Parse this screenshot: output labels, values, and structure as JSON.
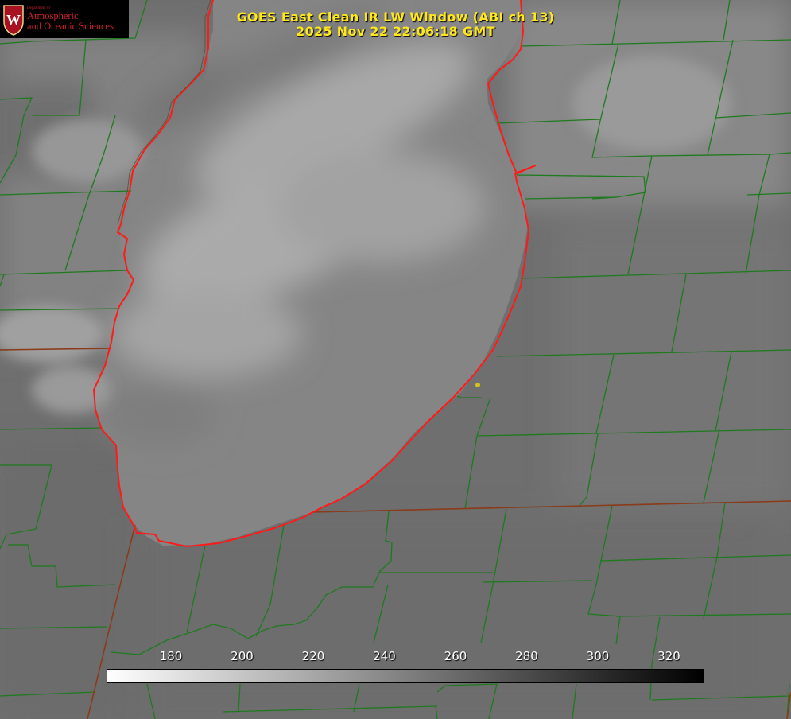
{
  "title": {
    "line1": "GOES East Clean IR LW Window (ABI ch 13)",
    "line2": "2025 Nov 22 22:06:18 GMT"
  },
  "logo": {
    "dept": "Department of",
    "line1": "Atmospheric",
    "line2": "and Oceanic Sciences",
    "seal_letter": "W",
    "color": "#cc1f2d"
  },
  "colorbar": {
    "ticks": [
      "180",
      "200",
      "220",
      "240",
      "260",
      "280",
      "300",
      "320"
    ],
    "tick_values": [
      180,
      200,
      220,
      240,
      260,
      280,
      300,
      320
    ],
    "colors": {
      "cold": "#ffffff",
      "warm": "#000000"
    }
  },
  "map": {
    "colors": {
      "county_lines": "#1e7a1e",
      "state_lines": "#8b3a1a",
      "coastline": "#ff1a1a",
      "marker": "#d4c21a"
    }
  }
}
